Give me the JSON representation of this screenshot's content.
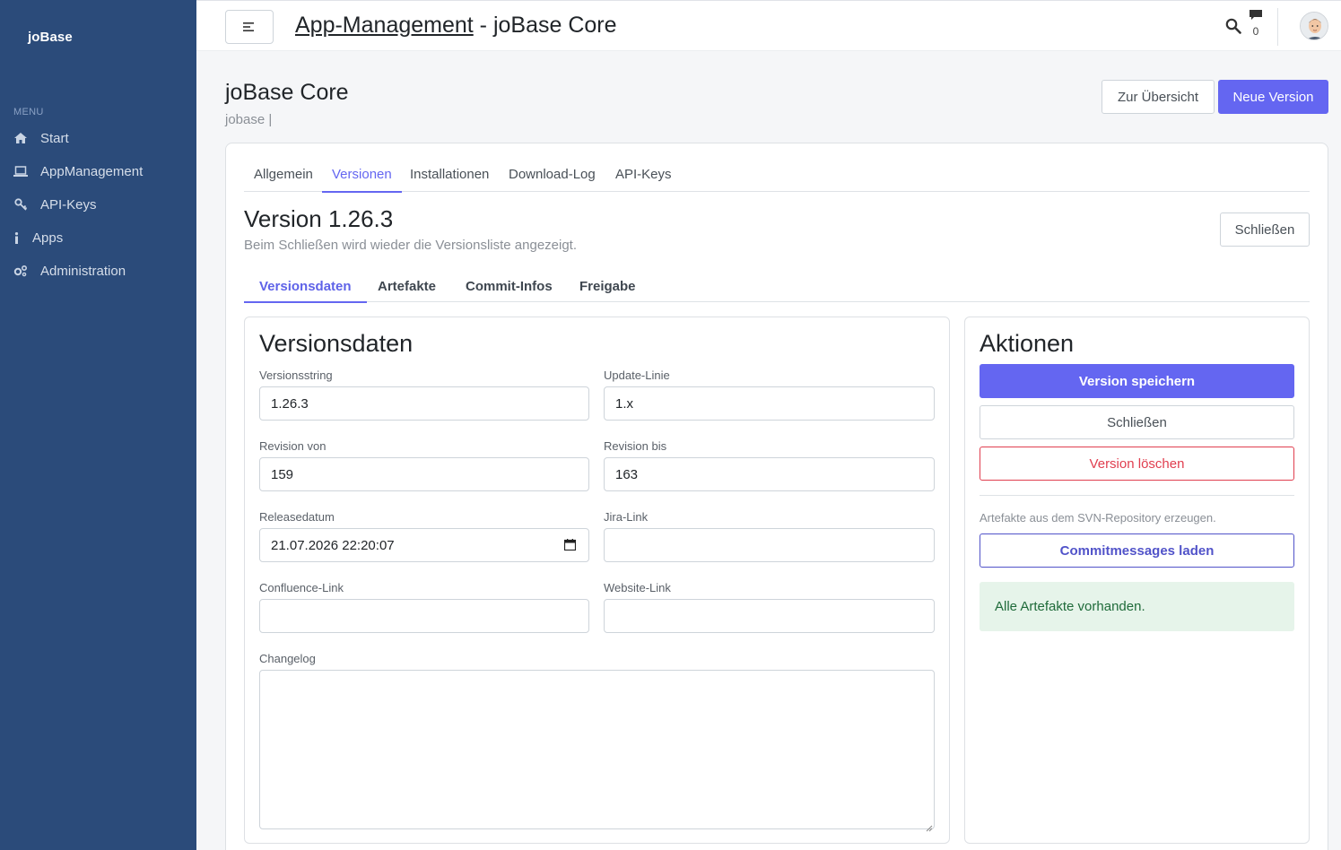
{
  "sidebar": {
    "brand": "joBase",
    "menu_label": "MENU",
    "items": [
      {
        "label": "Start",
        "icon": "home-icon"
      },
      {
        "label": "AppManagement",
        "icon": "laptop-icon"
      },
      {
        "label": "API-Keys",
        "icon": "key-icon"
      },
      {
        "label": "Apps",
        "icon": "info-icon"
      },
      {
        "label": "Administration",
        "icon": "gears-icon"
      }
    ]
  },
  "topbar": {
    "title_link": "App-Management",
    "title_rest": " - joBase Core",
    "message_count": "0"
  },
  "header": {
    "title": "joBase Core",
    "subtitle": "jobase |",
    "overview_button": "Zur Übersicht",
    "new_version_button": "Neue Version"
  },
  "main_tabs": [
    "Allgemein",
    "Versionen",
    "Installationen",
    "Download-Log",
    "API-Keys"
  ],
  "main_tabs_active": "Versionen",
  "version": {
    "title": "Version 1.26.3",
    "subtitle": "Beim Schließen wird wieder die Versionsliste angezeigt.",
    "close_button": "Schließen"
  },
  "sub_tabs": [
    "Versionsdaten",
    "Artefakte",
    "Commit-Infos",
    "Freigabe"
  ],
  "sub_tabs_active": "Versionsdaten",
  "form": {
    "title": "Versionsdaten",
    "versionsstring_label": "Versionsstring",
    "versionsstring_value": "1.26.3",
    "update_linie_label": "Update-Linie",
    "update_linie_value": "1.x",
    "revision_von_label": "Revision von",
    "revision_von_value": "159",
    "revision_bis_label": "Revision bis",
    "revision_bis_value": "163",
    "releasedatum_label": "Releasedatum",
    "releasedatum_value": "21.07.2026 22:20:07",
    "jira_label": "Jira-Link",
    "jira_value": "",
    "confluence_label": "Confluence-Link",
    "confluence_value": "",
    "website_label": "Website-Link",
    "website_value": "",
    "changelog_label": "Changelog",
    "changelog_value": ""
  },
  "actions": {
    "title": "Aktionen",
    "save_button": "Version speichern",
    "close_button": "Schließen",
    "delete_button": "Version löschen",
    "hint": "Artefakte aus dem SVN-Repository erzeugen.",
    "commit_button": "Commitmessages laden",
    "alert": "Alle Artefakte vorhanden."
  },
  "colors": {
    "sidebar": "#2b4b7a",
    "primary": "#6466f1",
    "danger": "#e03e4f",
    "success_bg": "#e6f4ea"
  }
}
